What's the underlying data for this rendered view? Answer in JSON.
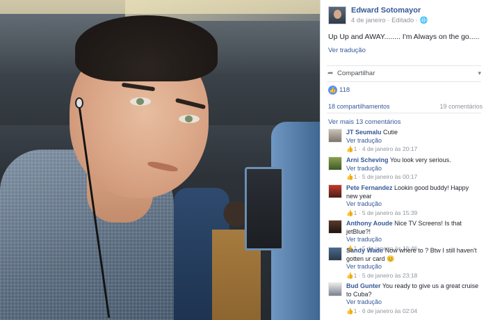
{
  "post": {
    "author": "Edward Sotomayor",
    "meta": "4 de janeiro · Editado · ",
    "globe_icon": "globe-icon",
    "text": "Up Up and AWAY........ I'm Always on the go.....",
    "see_translation": "Ver tradução"
  },
  "actions": {
    "share_label": "Compartilhar",
    "share_icon": "share-icon",
    "caret": "▾"
  },
  "reactions": {
    "like_icon": "👍",
    "count": "118"
  },
  "stats": {
    "shares": "18 compartilhamentos",
    "comments": "19 comentários"
  },
  "more_comments": "Ver mais 13 comentários",
  "comments": [
    {
      "name": "JT Seumalu",
      "text": " Cutie",
      "translate": "Ver tradução",
      "meta": "1 · 4 de janeiro às 20:17"
    },
    {
      "name": "Arni Scheving",
      "text": " You look very serious.",
      "translate": "Ver tradução",
      "meta": "1 · 5 de janeiro às 00:17"
    },
    {
      "name": "Pete Fernandez",
      "text": " Lookin good buddy! Happy new year",
      "translate": "Ver tradução",
      "meta": "1 · 5 de janeiro às 15:39"
    },
    {
      "name": "Anthony Aoude",
      "text": " Nice TV Screens! Is that jetBlue?!",
      "translate": "Ver tradução",
      "meta": "1 · 5 de janeiro às 16:46"
    },
    {
      "name": "Sandy Wade",
      "text": " Now where to ? Btw I still haven't gotten ur card 😊",
      "translate": "Ver tradução",
      "meta": "1 · 5 de janeiro às 23:18"
    },
    {
      "name": "Bud Gunter",
      "text": " You ready to give us a great cruise to Cuba?",
      "translate": "Ver tradução",
      "meta": "1 · 6 de janeiro às 02:04"
    }
  ],
  "colors": {
    "link": "#365899",
    "like_blue": "#5890ff",
    "muted": "#90949c"
  }
}
